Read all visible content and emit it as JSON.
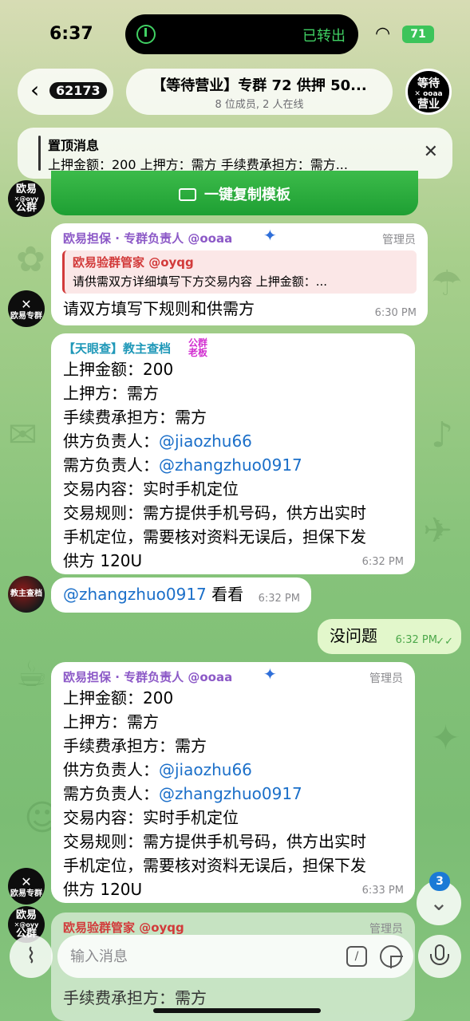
{
  "status_bar": {
    "time": "6:37",
    "live_activity": "已转出",
    "battery": "71"
  },
  "header": {
    "back_count": "62173",
    "title": "【等待营业】专群 72 供押 50...",
    "subtitle": "8 位成员, 2 人在线",
    "avatar_text_1": "等待",
    "avatar_text_2": "营业"
  },
  "pinned": {
    "title": "置顶消息",
    "text": "上押金额：200 上押方：需方 手续费承担方：需方..."
  },
  "copy_button": {
    "label": "一键复制模板"
  },
  "avatars": {
    "group": "欧易\n公群",
    "bot": "欧易专群",
    "user": "教主查档"
  },
  "messages": [
    {
      "sender": "欧易担保 · 专群负责人 @ooaa",
      "role": "管理员",
      "reply": {
        "name": "欧易验群管家 @oyqg",
        "text": "请供需双方详细填写下方交易内容 上押金额：..."
      },
      "text": "请双方填写下规则和供需方",
      "time": "6:30 PM"
    },
    {
      "sender": "【天眼查】教主查档",
      "tag": "公群\n老板",
      "lines": {
        "amount": "上押金额：200",
        "party": "上押方：需方",
        "fee": "手续费承担方：需方",
        "supplier_label": "供方负责人：",
        "supplier": "@jiaozhu66",
        "demander_label": "需方负责人：",
        "demander": "@zhangzhuo0917",
        "content": "交易内容：实时手机定位",
        "rule_1": "交易规则：需方提供手机号码，供方出实时",
        "rule_2": "手机定位，需要核对资料无误后，担保下发",
        "rule_3": "供方 120U"
      },
      "time": "6:32 PM"
    },
    {
      "mention": "@zhangzhuo0917",
      "text": "看看",
      "time": "6:32 PM"
    },
    {
      "text": "没问题",
      "time": "6:32 PM",
      "outgoing": true
    },
    {
      "sender": "欧易担保 · 专群负责人 @ooaa",
      "role": "管理员",
      "lines": {
        "amount": "上押金额：200",
        "party": "上押方：需方",
        "fee": "手续费承担方：需方",
        "supplier_label": "供方负责人：",
        "supplier": "@jiaozhu66",
        "demander_label": "需方负责人：",
        "demander": "@zhangzhuo0917",
        "content": "交易内容：实时手机定位",
        "rule_1": "交易规则：需方提供手机号码，供方出实时",
        "rule_2": "手机定位，需要核对资料无误后，担保下发",
        "rule_3": "供方 120U"
      },
      "time": "6:33 PM"
    },
    {
      "sender": "欧易验群管家 @oyqg",
      "role": "管理员",
      "peek_line": "手续费承担方：需方"
    }
  ],
  "scroll": {
    "unread": "3"
  },
  "input": {
    "placeholder": "输入消息"
  },
  "colors": {
    "accent_green": "#1e9f33",
    "link": "#1b6fc9",
    "admin_name": "#8c59c7"
  },
  "icons": [
    "back-chevron-icon",
    "close-icon",
    "keyboard-icon",
    "attach-icon",
    "command-icon",
    "sticker-icon",
    "mic-icon",
    "chevron-down-icon",
    "read-check-icon"
  ]
}
